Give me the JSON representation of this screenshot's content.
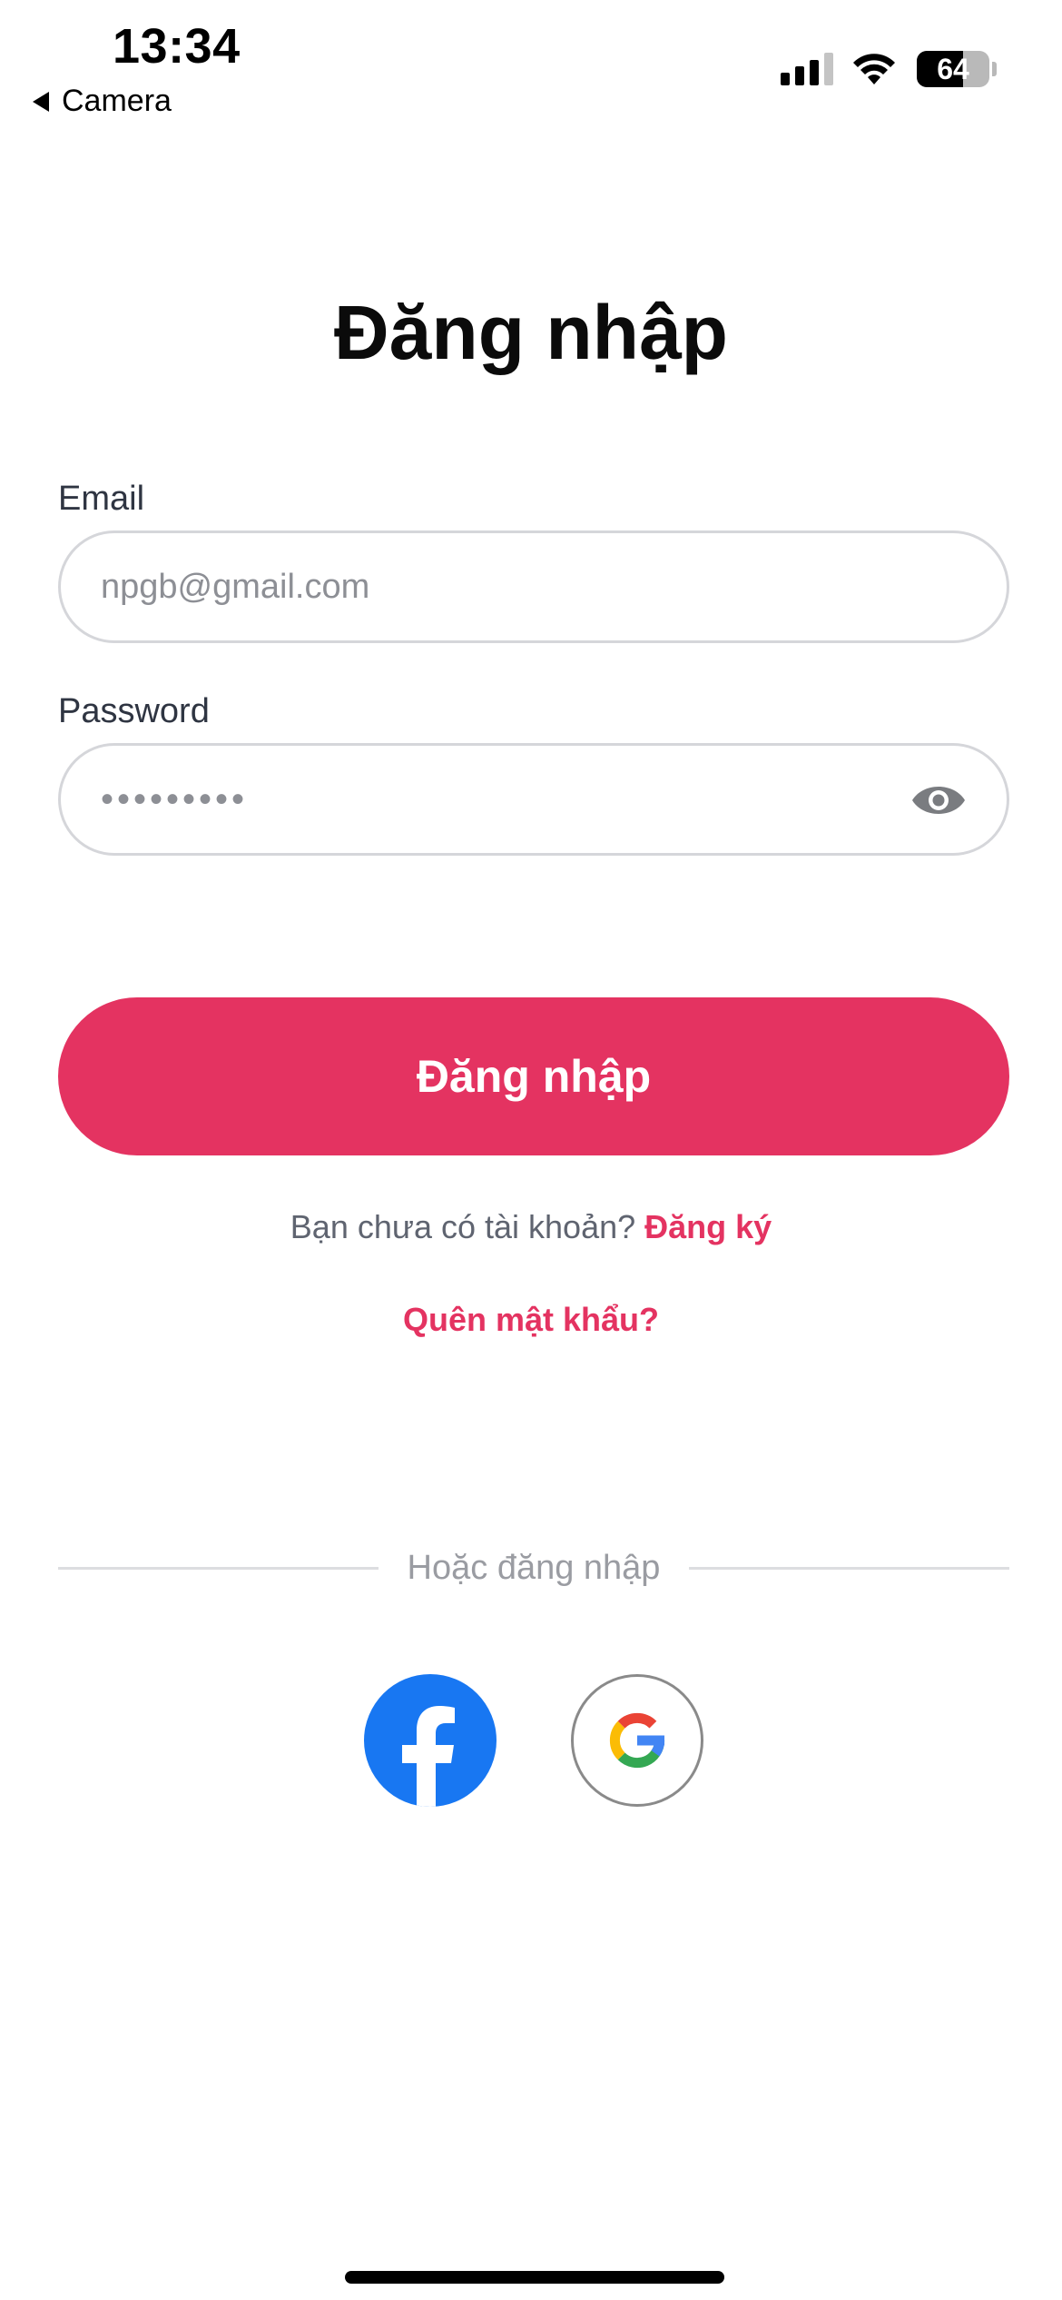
{
  "status_bar": {
    "time": "13:34",
    "back_label": "Camera",
    "battery_percent": "64",
    "battery_level": 0.64,
    "signal_bars_active": 3,
    "signal_bars_total": 4
  },
  "login": {
    "title": "Đăng nhập",
    "email_label": "Email",
    "email_value": "npgb@gmail.com",
    "password_label": "Password",
    "password_masked": "•••••••••",
    "submit_label": "Đăng nhập",
    "no_account_text": "Bạn chưa có tài khoản?",
    "register_link": "Đăng ký",
    "forgot_password": "Quên mật khẩu?"
  },
  "social": {
    "divider_text": "Hoặc đăng nhập",
    "providers": [
      {
        "name": "facebook",
        "icon": "facebook-icon",
        "color": "#1877f2"
      },
      {
        "name": "google",
        "icon": "google-icon",
        "color": "#4285f4"
      }
    ]
  },
  "colors": {
    "accent": "#e43361",
    "input_border": "#d5d6da",
    "placeholder_text": "#8d8f95"
  }
}
